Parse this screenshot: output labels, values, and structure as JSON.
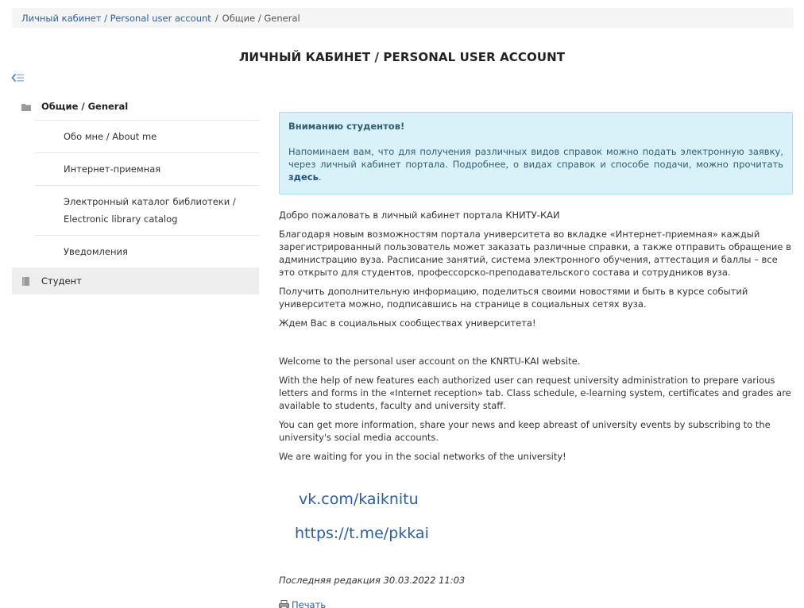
{
  "breadcrumb": {
    "items": [
      "Личный кабинет / Personal user account",
      "Общие / General"
    ],
    "separator": "/"
  },
  "page_title": "ЛИЧНЫЙ КАБИНЕТ / PERSONAL USER ACCOUNT",
  "sidebar": {
    "toggle_icon": "collapse-sidebar-icon",
    "group_general": "Общие / General",
    "items": [
      "Обо мне / About me",
      "Интернет-приемная",
      "Электронный каталог библиотеки / Electronic library catalog",
      "Уведомления"
    ],
    "group_student": "Студент"
  },
  "notice": {
    "title": "Вниманию студентов!",
    "text": "Напоминаем вам, что для получения различных видов справок можно подать электронную заявку, через личный кабинет портала. Подробнее, о видах справок и способе подачи, можно прочитать",
    "link": "здесь",
    "end": "."
  },
  "body_ru": [
    "Добро пожаловать в личный кабинет портала КНИТУ-КАИ",
    "Благодаря новым возможностям портала университета во вкладке «Интернет-приемная» каждый зарегистрированный пользователь  может заказать различные справки, а также отправить обращение в администрацию вуза. Расписание занятий, система электронного обучения, аттестация и баллы – все это открыто для студентов, профессорско-преподавательского состава и сотрудников вуза.",
    "Получить дополнительную информацию, поделиться своими новостями и быть в курсе событий университета можно, подписавшись на странице в социальных сетях вуза.",
    "Ждем Вас в социальных сообществах университета!"
  ],
  "body_en": [
    "Welcome to the personal user account on the KNRTU-KAI website.",
    "With the help of new features each authorized user can request university administration to prepare various letters and forms in the «Internet reception» tab. Class schedule, e-learning system, certificates and grades are available to students, faculty and university staff.",
    "You can get more information, share your news and keep abreast of university events by subscribing to the university's social media accounts.",
    "We are waiting for you in the social networks of the university!"
  ],
  "social": {
    "vk": "vk.com/kaiknitu",
    "telegram": "https://t.me/pkkai"
  },
  "last_edit": "Последняя редакция 30.03.2022 11:03",
  "print_label": "Печать",
  "colors": {
    "link": "#2a5ea8",
    "notice_bg": "#d9f1f9",
    "notice_border": "#abdeef",
    "notice_text": "#2f5f73",
    "active_row": "#eeeeee"
  }
}
